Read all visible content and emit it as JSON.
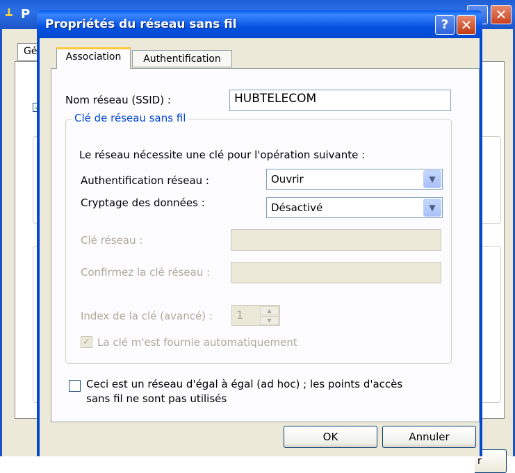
{
  "background_window": {
    "title": "P",
    "tab_label": "Gé",
    "button_label": "r"
  },
  "dialog": {
    "title": "Propriétés du réseau sans fil",
    "help_label": "?",
    "close_label": "✕"
  },
  "tabs": [
    {
      "label": "Association",
      "active": true
    },
    {
      "label": "Authentification",
      "active": false
    }
  ],
  "ssid": {
    "label": "Nom réseau (SSID) :",
    "value": "HUBTELECOM"
  },
  "key_group": {
    "legend": "Clé de réseau sans fil",
    "description": "Le réseau nécessite une clé pour l'opération suivante :",
    "auth_label": "Authentification réseau :",
    "auth_value": "Ouvrir",
    "encryption_label": "Cryptage des données :",
    "encryption_value": "Désactivé",
    "network_key_label": "Clé réseau :",
    "network_key_value": "",
    "confirm_key_label": "Confirmez la clé réseau :",
    "confirm_key_value": "",
    "key_index_label": "Index de la clé (avancé) :",
    "key_index_value": "1",
    "auto_key_label": "La clé m'est fournie automatiquement",
    "auto_key_checked": true
  },
  "adhoc": {
    "label_line1": "Ceci est un réseau d'égal à égal (ad hoc) ; les points d'accès",
    "label_line2": "sans fil ne sont pas utilisés",
    "checked": false
  },
  "buttons": {
    "ok": "OK",
    "cancel": "Annuler"
  },
  "colors": {
    "titlebar": "#0149cf",
    "dialog_bg": "#ece9d8",
    "group_legend": "#0046d5",
    "disabled_text": "#aca899",
    "active_tab_accent": "#ffc83c"
  }
}
